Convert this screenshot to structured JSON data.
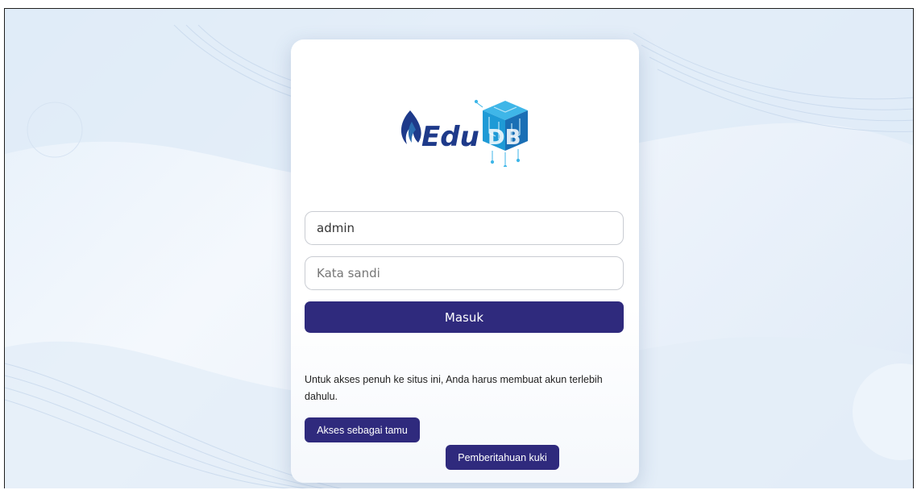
{
  "login": {
    "logo_alt": "EduDB",
    "username_value": "admin",
    "password_placeholder": "Kata sandi",
    "login_label": "Masuk",
    "info_text": "Untuk akses penuh ke situs ini, Anda harus membuat akun terlebih dahulu.",
    "guest_label": "Akses sebagai tamu",
    "cookie_label": "Pemberitahuan kuki"
  },
  "colors": {
    "primary": "#2f2a7d",
    "logo_blue": "#1e3a8a",
    "logo_cyan": "#1e9ad6"
  }
}
